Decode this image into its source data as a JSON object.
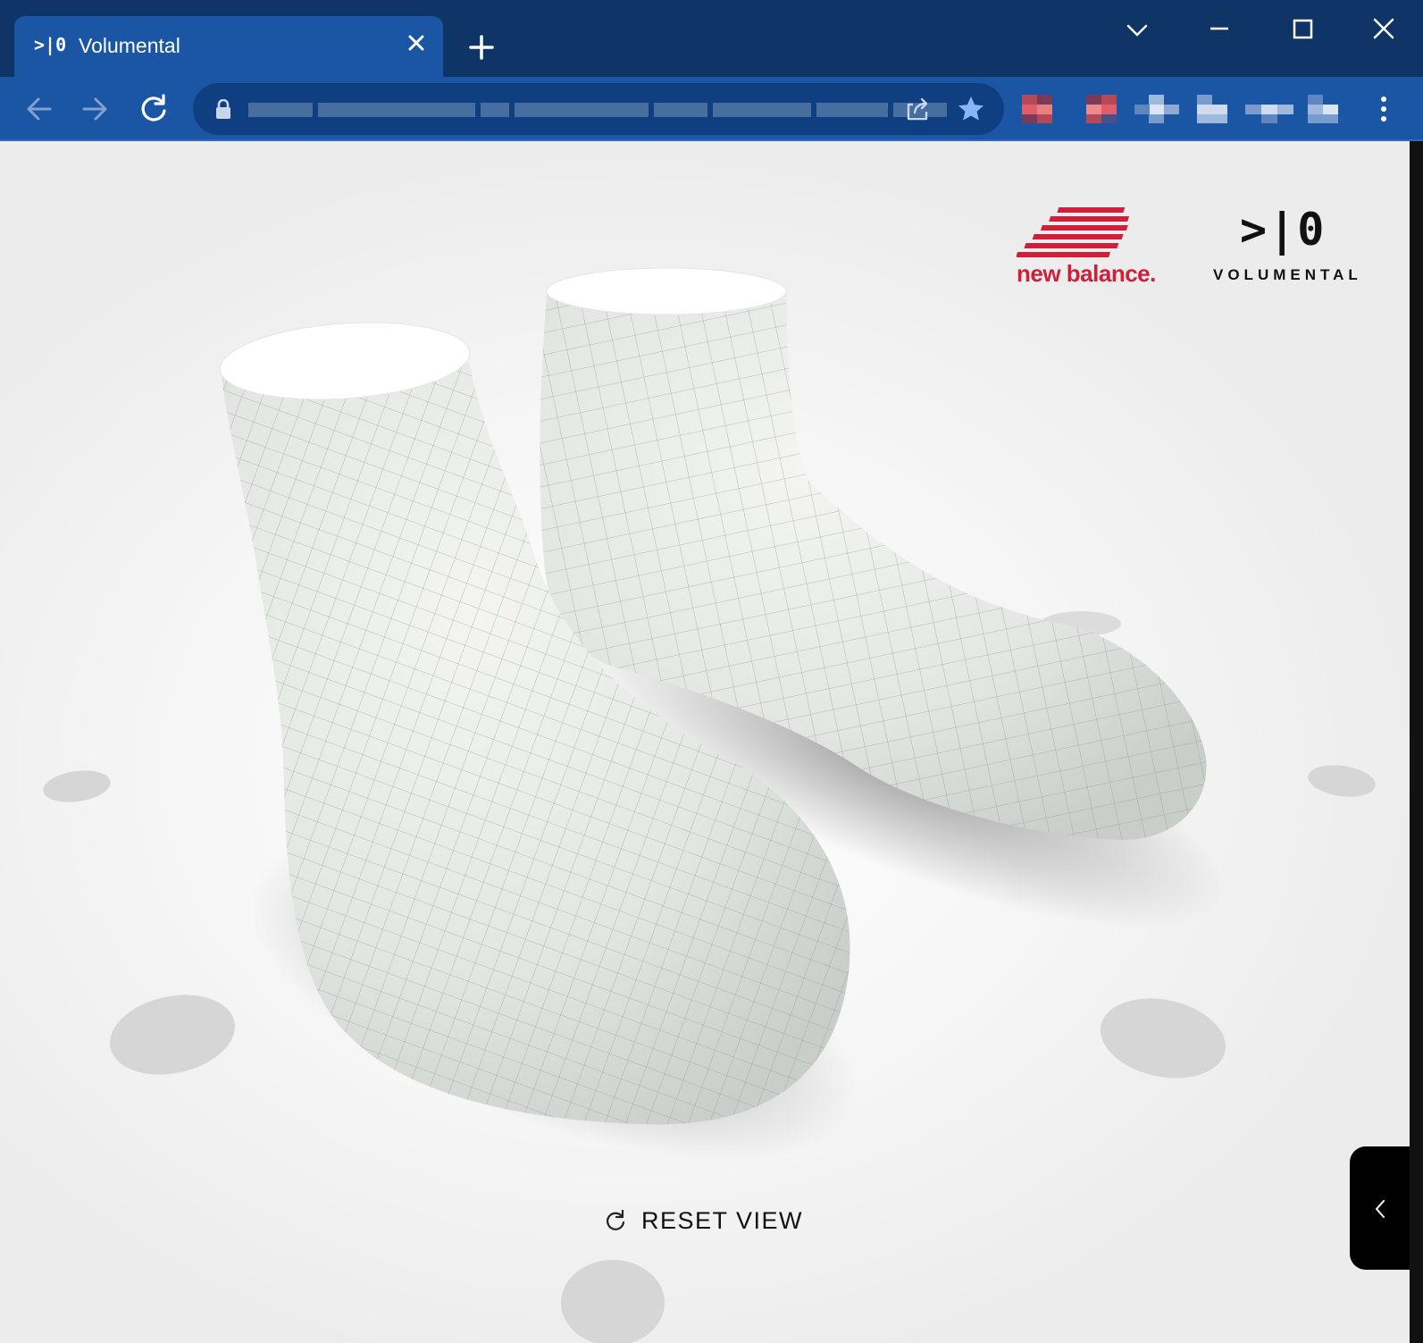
{
  "browser": {
    "tab": {
      "favicon_text": ">|0",
      "title": "Volumental"
    },
    "address_bar": {
      "url": ""
    }
  },
  "page": {
    "brand_newbalance": "new balance.",
    "brand_volumental_mark": ">|0",
    "brand_volumental_word": "VOLUMENTAL",
    "reset_view_label": "RESET VIEW"
  },
  "colors": {
    "chrome_dark": "#0e3566",
    "chrome_tab": "#1a56a3",
    "newbalance_red": "#cf1f3a",
    "star_blue": "#8ab4f8"
  },
  "icons": [
    "tab-close-icon",
    "new-tab-icon",
    "tab-list-icon",
    "minimize-icon",
    "maximize-icon",
    "close-icon",
    "back-arrow-icon",
    "forward-arrow-icon",
    "reload-icon",
    "lock-icon",
    "share-icon",
    "bookmark-star-icon",
    "kebab-menu-icon",
    "reset-icon",
    "chevron-left-icon"
  ]
}
